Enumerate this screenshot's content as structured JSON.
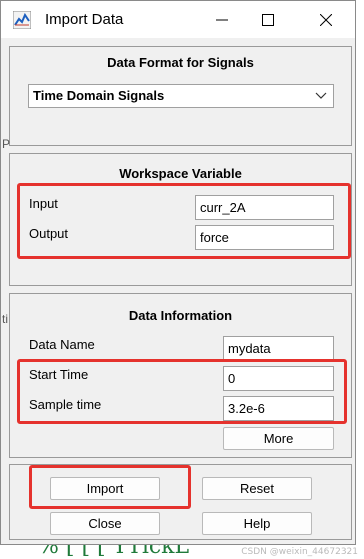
{
  "window": {
    "title": "Import Data"
  },
  "data_format": {
    "title": "Data Format for Signals",
    "selected": "Time Domain Signals"
  },
  "workspace": {
    "title": "Workspace Variable",
    "input_label": "Input",
    "input_value": "curr_2A",
    "output_label": "Output",
    "output_value": "force"
  },
  "data_info": {
    "title": "Data Information",
    "name_label": "Data Name",
    "name_value": "mydata",
    "start_label": "Start Time",
    "start_value": "0",
    "sample_label": "Sample time",
    "sample_value": "3.2e-6",
    "more_label": "More"
  },
  "buttons": {
    "import": "Import",
    "reset": "Reset",
    "close": "Close",
    "help": "Help"
  },
  "background": {
    "left_fragments": [
      "P",
      "ti",
      "or"
    ],
    "bottom_text": "%  ⌊ ⌊         ⌊  YTickL",
    "watermark": "CSDN @weixin_44672321"
  },
  "colors": {
    "highlight": "#e5322d",
    "panel": "#f0f0f0"
  }
}
